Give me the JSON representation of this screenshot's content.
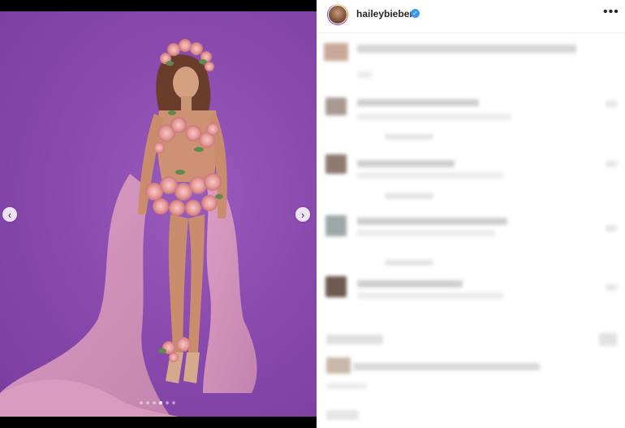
{
  "post": {
    "username": "haileybieber",
    "verified_icon": "verified-badge-icon",
    "more_icon": "more-options-icon",
    "more_label": "•••"
  },
  "carousel": {
    "prev_icon": "chevron-left-icon",
    "next_icon": "chevron-right-icon",
    "prev_glyph": "‹",
    "next_glyph": "›",
    "dot_count": 6,
    "active_index": 3
  },
  "colors": {
    "background": "#8a4aae",
    "verified": "#3897f0",
    "text": "#262626"
  }
}
